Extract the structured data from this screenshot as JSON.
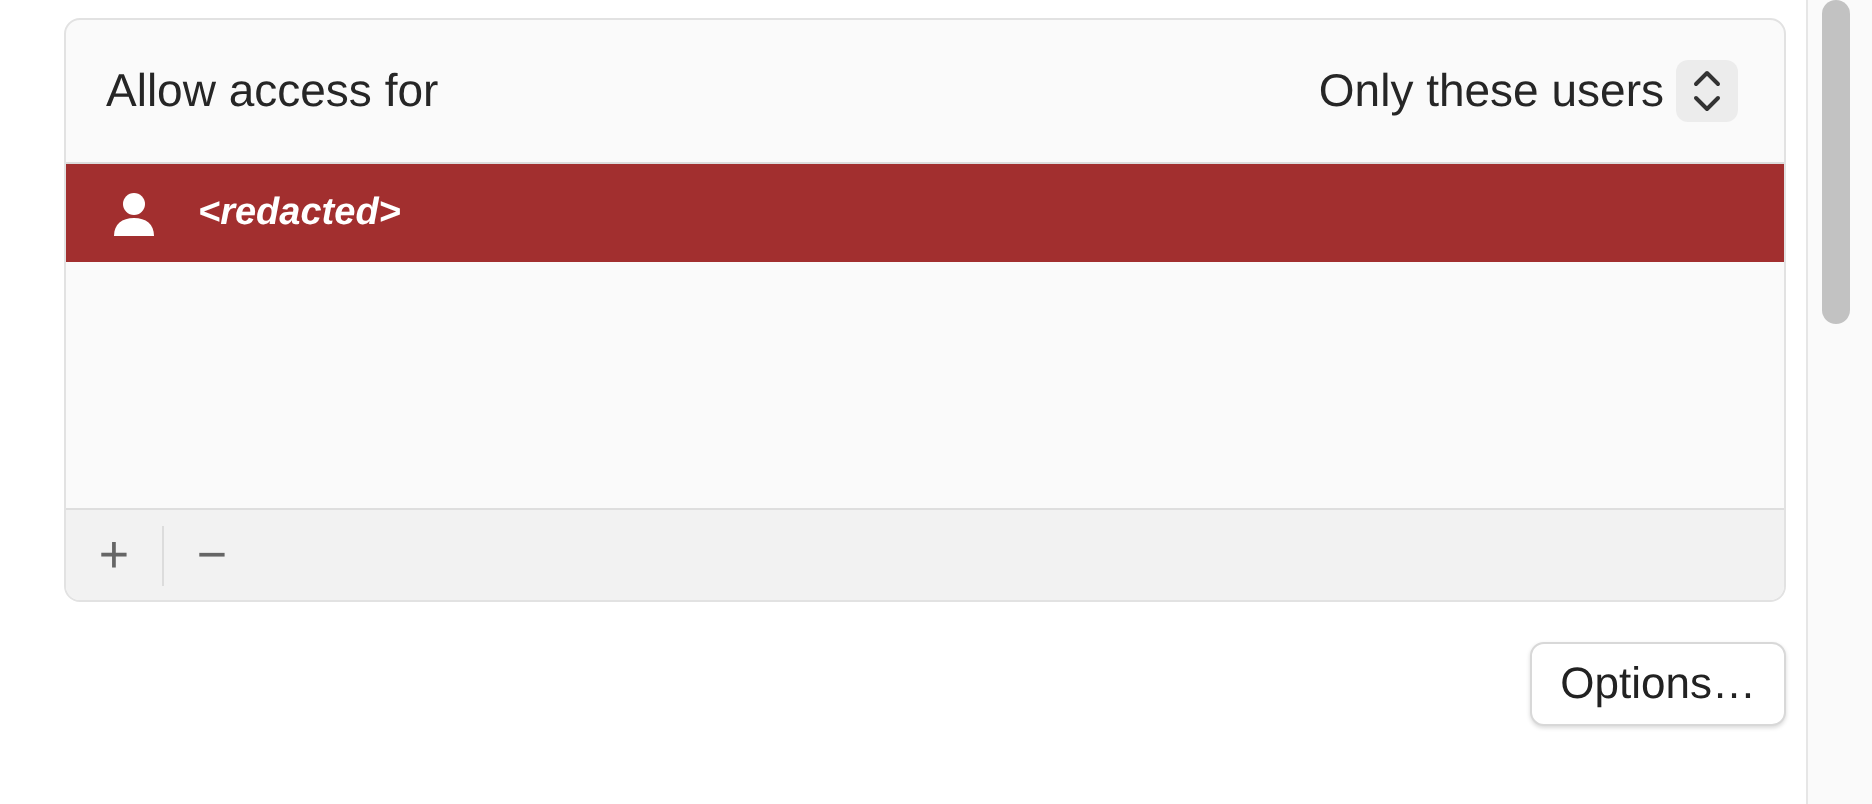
{
  "access": {
    "label": "Allow access for",
    "popup_value": "Only these users"
  },
  "users": [
    {
      "name": "<redacted>",
      "selected": true
    }
  ],
  "list_buttons": [
    "+",
    "−"
  ],
  "options_button": "Options…"
}
